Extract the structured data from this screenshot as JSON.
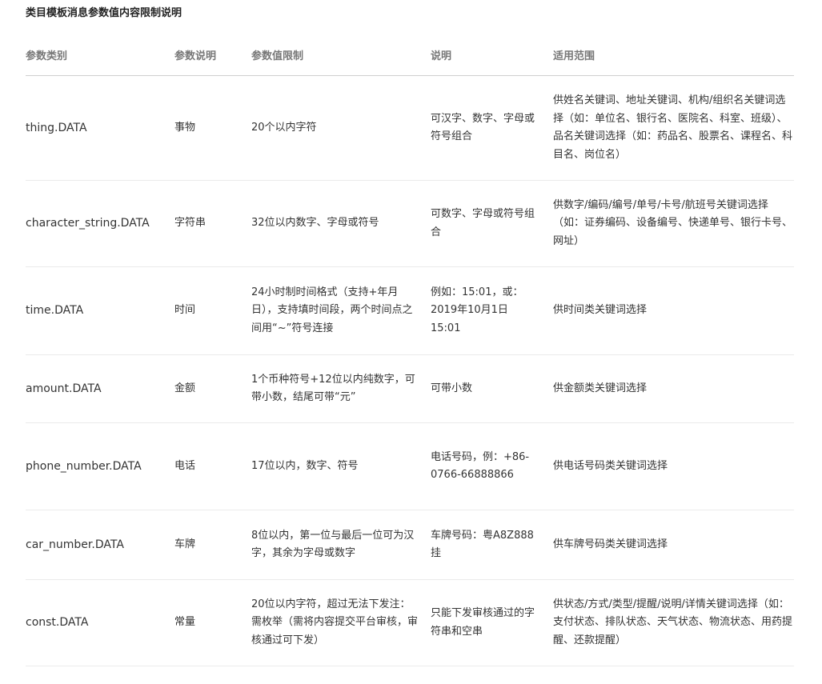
{
  "title": "类目模板消息参数值内容限制说明",
  "headers": [
    "参数类别",
    "参数说明",
    "参数值限制",
    "说明",
    "适用范围"
  ],
  "rows": [
    {
      "category": "thing.DATA",
      "desc": "事物",
      "limit": "20个以内字符",
      "note": "可汉字、数字、字母或符号组合",
      "scope": "供姓名关键词、地址关键词、机构/组织名关键词选择（如：单位名、银行名、医院名、科室、班级）、品名关键词选择（如：药品名、股票名、课程名、科目名、岗位名）"
    },
    {
      "category": "character_string.DATA",
      "desc": "字符串",
      "limit": "32位以内数字、字母或符号",
      "note": "可数字、字母或符号组合",
      "scope": "供数字/编码/编号/单号/卡号/航班号关键词选择（如：证券编码、设备编号、快递单号、银行卡号、网址）"
    },
    {
      "category": "time.DATA",
      "desc": "时间",
      "limit": "24小时制时间格式（支持+年月日），支持填时间段，两个时间点之间用“~”符号连接",
      "note": "例如：15:01，或：2019年10月1日 15:01",
      "scope": "供时间类关键词选择"
    },
    {
      "category": "amount.DATA",
      "desc": "金额",
      "limit": "1个币种符号+12位以内纯数字，可带小数，结尾可带“元”",
      "note": "可带小数",
      "scope": "供金额类关键词选择"
    },
    {
      "category": "phone_number.DATA",
      "desc": "电话",
      "limit": "17位以内，数字、符号",
      "note": "电话号码，例：+86-0766-66888866",
      "scope": "供电话号码类关键词选择"
    },
    {
      "category": "car_number.DATA",
      "desc": "车牌",
      "limit": "8位以内，第一位与最后一位可为汉字，其余为字母或数字",
      "note": "车牌号码：粤A8Z888挂",
      "scope": "供车牌号码类关键词选择"
    },
    {
      "category": "const.DATA",
      "desc": "常量",
      "limit": "20位以内字符，超过无法下发注：需枚举（需将内容提交平台审核，审核通过可下发）",
      "note": "只能下发审核通过的字符串和空串",
      "scope": "供状态/方式/类型/提醒/说明/详情关键词选择（如：支付状态、排队状态、天气状态、物流状态、用药提醒、还款提醒）"
    }
  ]
}
